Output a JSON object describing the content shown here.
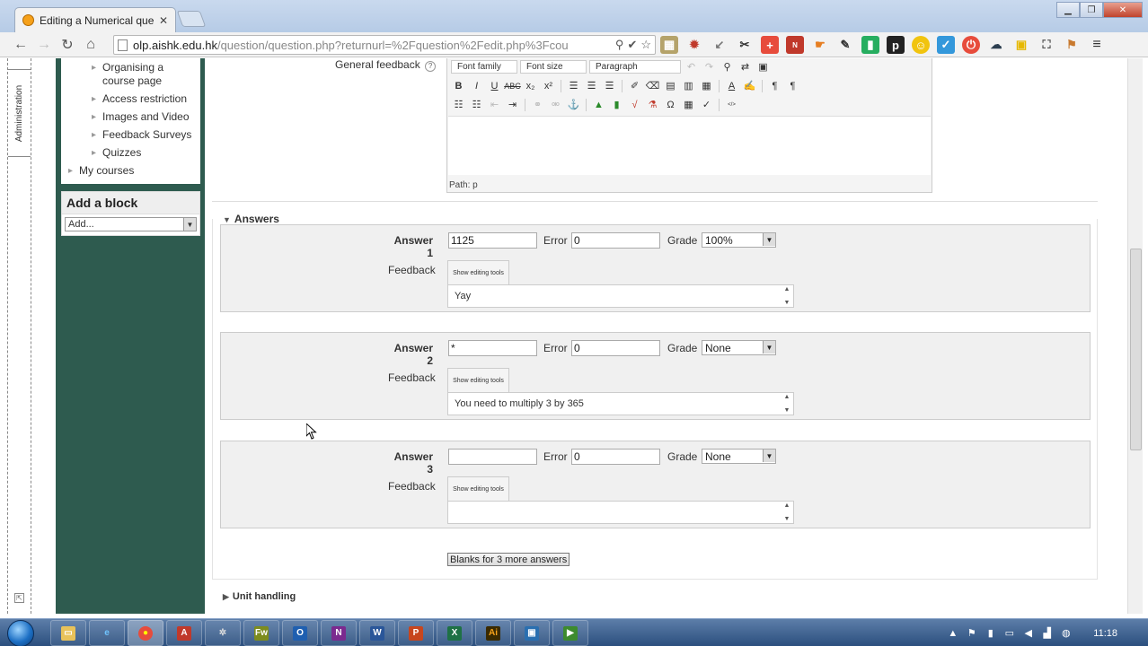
{
  "browser": {
    "tab_title": "Editing a Numerical quest",
    "url_host": "olp.aishk.edu.hk",
    "url_path": "/question/question.php?returnurl=%2Fquestion%2Fedit.php%3Fcou"
  },
  "dock": {
    "label": "Administration"
  },
  "sidebar": {
    "nav_items": [
      {
        "label": "Organising a course page"
      },
      {
        "label": "Access restriction"
      },
      {
        "label": "Images and Video"
      },
      {
        "label": "Feedback Surveys"
      },
      {
        "label": "Quizzes"
      }
    ],
    "my_courses": "My courses",
    "add_block": {
      "title": "Add a block",
      "select_value": "Add..."
    }
  },
  "general_feedback": {
    "label": "General feedback",
    "font_family": "Font family",
    "font_size": "Font size",
    "format": "Paragraph",
    "path": "Path: p"
  },
  "answers": {
    "legend": "Answers",
    "error_label": "Error",
    "grade_label": "Grade",
    "feedback_label": "Feedback",
    "show_tools_label": "Show editing tools",
    "items": [
      {
        "label": "Answer 1",
        "answer": "1125",
        "error": "0",
        "grade": "100%",
        "feedback": "Yay"
      },
      {
        "label": "Answer 2",
        "answer": "*",
        "error": "0",
        "grade": "None",
        "feedback": "You need to multiply 3 by 365"
      },
      {
        "label": "Answer 3",
        "answer": "",
        "error": "0",
        "grade": "None",
        "feedback": ""
      }
    ],
    "blanks_button": "Blanks for 3 more answers"
  },
  "unit_handling": {
    "legend": "Unit handling"
  },
  "taskbar": {
    "clock": "11:18"
  }
}
